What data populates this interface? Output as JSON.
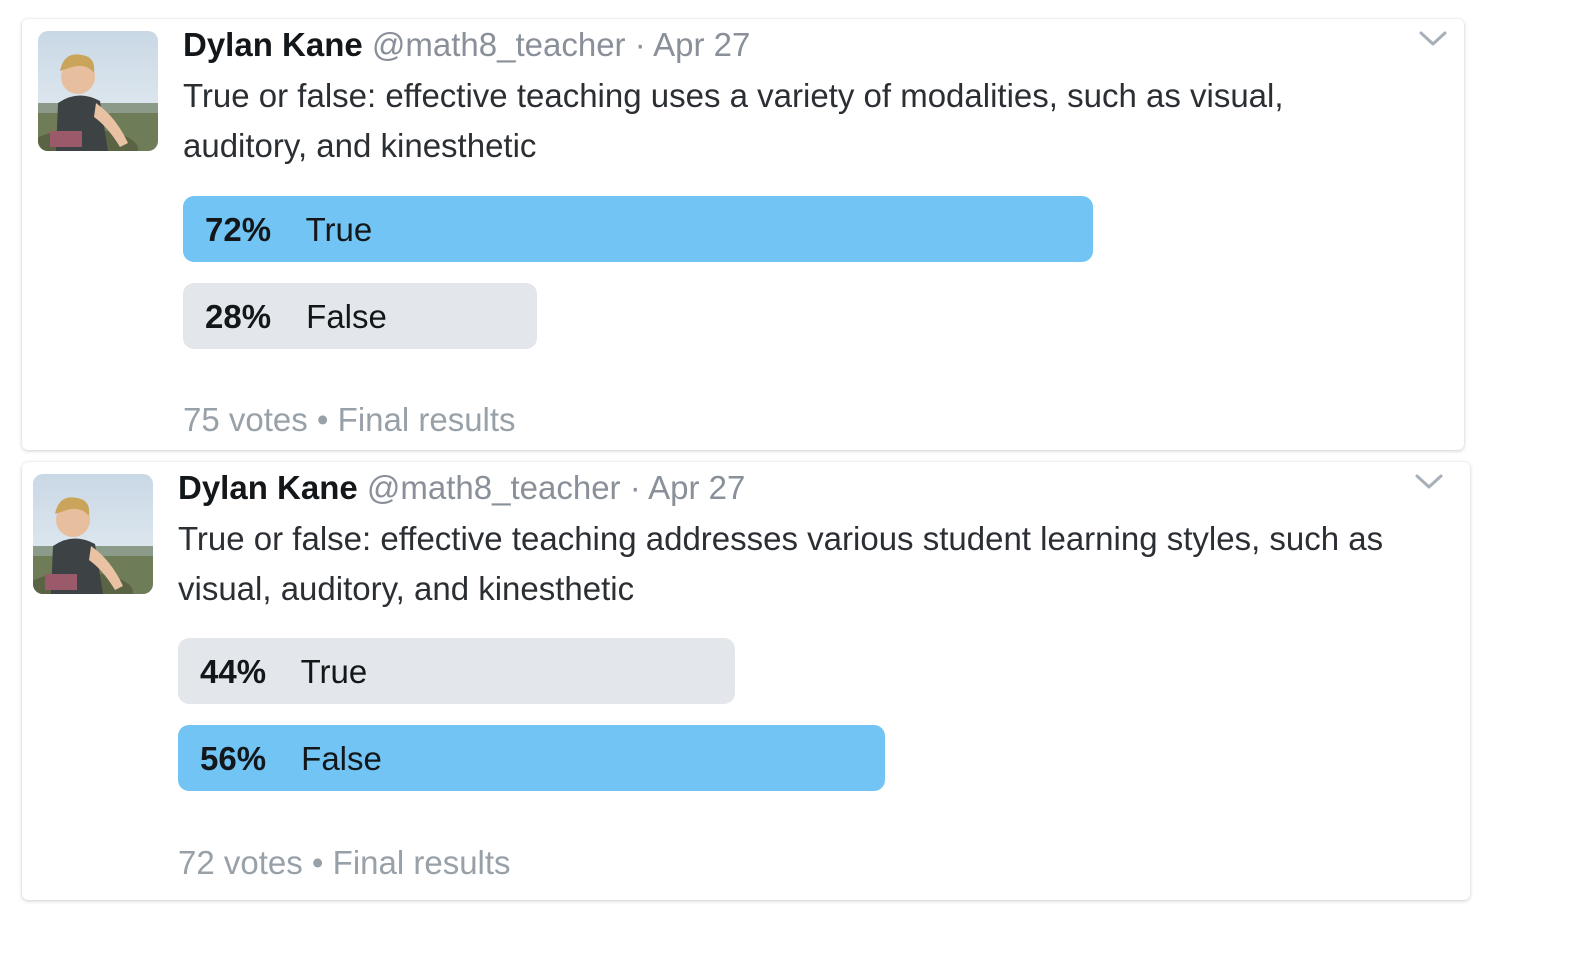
{
  "tweets": [
    {
      "author": {
        "display_name": "Dylan Kane",
        "handle": "@math8_teacher",
        "avatar_icon": "profile-photo"
      },
      "separator": "·",
      "date": "Apr 27",
      "text": "True or false: effective teaching uses a variety of modalities, such as visual, auditory, and kinesthetic",
      "poll": {
        "options": [
          {
            "percent_label": "72%",
            "choice": "True",
            "percent": 72,
            "winner": true
          },
          {
            "percent_label": "28%",
            "choice": "False",
            "percent": 28,
            "winner": false
          }
        ],
        "votes": "75 votes",
        "bullet": "•",
        "status": "Final results"
      },
      "menu_icon": "chevron-down-icon"
    },
    {
      "author": {
        "display_name": "Dylan Kane",
        "handle": "@math8_teacher",
        "avatar_icon": "profile-photo"
      },
      "separator": "·",
      "date": "Apr 27",
      "text": "True or false: effective teaching addresses various student learning styles, such as visual, auditory, and kinesthetic",
      "poll": {
        "options": [
          {
            "percent_label": "44%",
            "choice": "True",
            "percent": 44,
            "winner": false
          },
          {
            "percent_label": "56%",
            "choice": "False",
            "percent": 56,
            "winner": true
          }
        ],
        "votes": "72 votes",
        "bullet": "•",
        "status": "Final results"
      },
      "menu_icon": "chevron-down-icon"
    }
  ],
  "colors": {
    "winner_bar": "#71c4f4",
    "loser_bar": "#e3e7ec",
    "muted_text": "#8a9099"
  }
}
